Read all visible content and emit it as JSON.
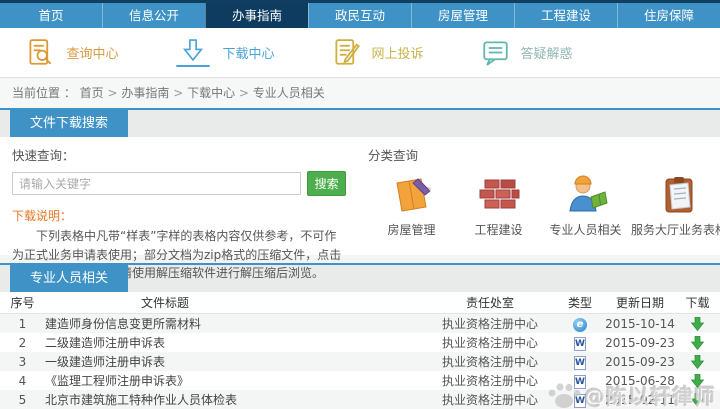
{
  "nav": {
    "tabs": [
      {
        "label": "首页",
        "active": false
      },
      {
        "label": "信息公开",
        "active": false
      },
      {
        "label": "办事指南",
        "active": true
      },
      {
        "label": "政民互动",
        "active": false
      },
      {
        "label": "房屋管理",
        "active": false
      },
      {
        "label": "工程建设",
        "active": false
      },
      {
        "label": "住房保障",
        "active": false
      }
    ]
  },
  "quicklinks": {
    "items": [
      {
        "label": "查询中心",
        "icon": "search-doc-icon",
        "color": "#d99a3f",
        "active": false
      },
      {
        "label": "下载中心",
        "icon": "download-icon",
        "color": "#4aa3d8",
        "active": true
      },
      {
        "label": "网上投诉",
        "icon": "complaint-doc-icon",
        "color": "#c9b34a",
        "active": false
      },
      {
        "label": "答疑解惑",
        "icon": "chat-bubble-icon",
        "color": "#8fb8b3",
        "active": false
      }
    ]
  },
  "breadcrumb": {
    "label": "当前位置 ：",
    "items": [
      {
        "label": "首页"
      },
      {
        "label": "办事指南"
      },
      {
        "label": "下载中心"
      },
      {
        "label": "专业人员相关"
      }
    ]
  },
  "search_section": {
    "title": "文件下载搜索",
    "quick_query_label": "快速查询：",
    "input_value": "",
    "input_placeholder": "请输入关键字",
    "search_button": "搜索",
    "note_title": "下载说明：",
    "note_text": "下列表格中凡带“样表”字样的表格内容仅供参考，不可作为正式业务申请表使用；部分文档为zip格式的压缩文件，点击下载后如不能打开，请使用解压缩软件进行解压缩后浏览。"
  },
  "category_section": {
    "title": "分类查询",
    "items": [
      {
        "label": "房屋管理",
        "icon": "house-management-icon"
      },
      {
        "label": "工程建设",
        "icon": "construction-bricks-icon"
      },
      {
        "label": "专业人员相关",
        "icon": "worker-icon"
      },
      {
        "label": "服务大厅业务表格",
        "icon": "clipboard-forms-icon"
      }
    ]
  },
  "table_section": {
    "title": "专业人员相关",
    "columns": [
      "序号",
      "文件标题",
      "责任处室",
      "类型",
      "更新日期",
      "下载"
    ],
    "rows": [
      {
        "no": "1",
        "title": "建造师身份信息变更所需材料",
        "dept": "执业资格注册中心",
        "type": "ie",
        "date": "2015-10-14"
      },
      {
        "no": "2",
        "title": "二级建造师注册申诉表",
        "dept": "执业资格注册中心",
        "type": "word",
        "date": "2015-09-23"
      },
      {
        "no": "3",
        "title": "一级建造师注册申诉表",
        "dept": "执业资格注册中心",
        "type": "word",
        "date": "2015-09-23"
      },
      {
        "no": "4",
        "title": "《监理工程师注册申诉表》",
        "dept": "执业资格注册中心",
        "type": "word",
        "date": "2015-06-28"
      },
      {
        "no": "5",
        "title": "北京市建筑施工特种作业人员体检表",
        "dept": "执业资格注册中心",
        "type": "word",
        "date": "2015-02-11"
      }
    ]
  },
  "watermark": {
    "text": "@陈以轩律师",
    "icon": "paw-icon"
  },
  "colors": {
    "nav_blue": "#3e92c5",
    "nav_active": "#0d3c60",
    "accent_blue": "#3e92c5",
    "search_green": "#4cae4c",
    "download_green": "#3fae49",
    "note_orange": "#e87722"
  }
}
